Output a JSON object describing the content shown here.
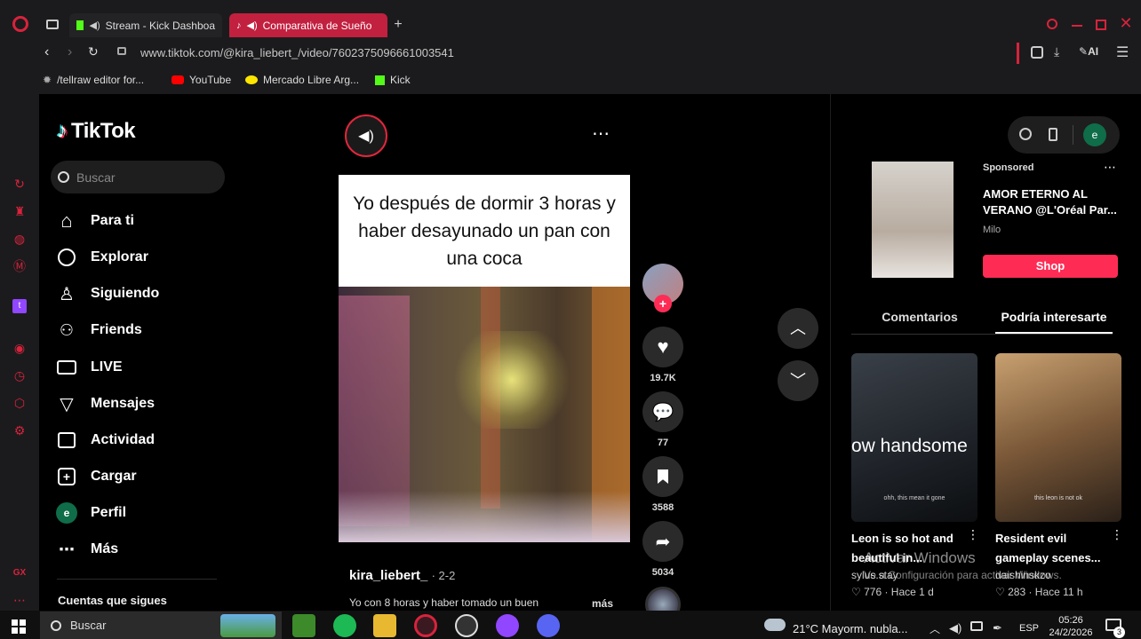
{
  "browser": {
    "tabs": [
      {
        "label": "Stream - Kick Dashboa",
        "icon": "kick-icon"
      },
      {
        "label": "Comparativa de Sueño",
        "icon": "tiktok-icon"
      }
    ],
    "url": "www.tiktok.com/@kira_liebert_/video/7602375096661003541",
    "ai_label": "AI",
    "bookmarks": [
      "/tellraw editor for...",
      "YouTube",
      "Mercado Libre Arg...",
      "Kick"
    ]
  },
  "tiktok": {
    "logo": "TikTok",
    "search_placeholder": "Buscar",
    "nav": [
      {
        "label": "Para ti",
        "icon": "home-icon"
      },
      {
        "label": "Explorar",
        "icon": "compass-icon"
      },
      {
        "label": "Siguiendo",
        "icon": "following-icon"
      },
      {
        "label": "Friends",
        "icon": "friends-icon"
      },
      {
        "label": "LIVE",
        "icon": "live-icon"
      },
      {
        "label": "Mensajes",
        "icon": "messages-icon"
      },
      {
        "label": "Actividad",
        "icon": "activity-icon"
      },
      {
        "label": "Cargar",
        "icon": "upload-icon"
      },
      {
        "label": "Perfil",
        "icon": "avatar-icon"
      },
      {
        "label": "Más",
        "icon": "more-icon"
      }
    ],
    "profile_initial": "e",
    "following_header": "Cuentas que sigues"
  },
  "video": {
    "caption_overlay": "Yo después de dormir 3 horas y haber desayunado un pan con una coca",
    "author": "kira_liebert_",
    "date": "· 2-2",
    "description": "Yo con 8 horas y haber tomado un buen",
    "more": "más",
    "likes": "19.7K",
    "comments": "77",
    "saves": "3588",
    "shares": "5034"
  },
  "right_panel": {
    "sponsored_label": "Sponsored",
    "ad_title": "AMOR ETERNO AL VERANO @L'Oréal Par...",
    "ad_brand": "Milo",
    "shop_button": "Shop",
    "tabs": [
      "Comentarios",
      "Podría interesarte"
    ],
    "cards": [
      {
        "overlay": "ow handsome",
        "subtitle": "ohh, this mean it gone",
        "title": "Leon is so hot and beautiful in...",
        "author": "sylus.stay",
        "stats": "♡ 776 · Hace 1 d"
      },
      {
        "overlay": "",
        "subtitle": "this leon is not ok",
        "title": "Resident evil gameplay scenes...",
        "author": "daishinskzo",
        "stats": "♡ 283 · Hace 11 h"
      }
    ],
    "watermark_1": "Activar Windows",
    "watermark_2": "Ve a Configuración para activar Windows."
  },
  "taskbar": {
    "search": "Buscar",
    "weather": "21°C  Mayorm. nubla...",
    "lang": "ESP",
    "time": "05:26",
    "date": "24/2/2026",
    "notif_count": "3"
  },
  "colors": {
    "accent": "#fe2c55",
    "opera_red": "#d8233c"
  }
}
